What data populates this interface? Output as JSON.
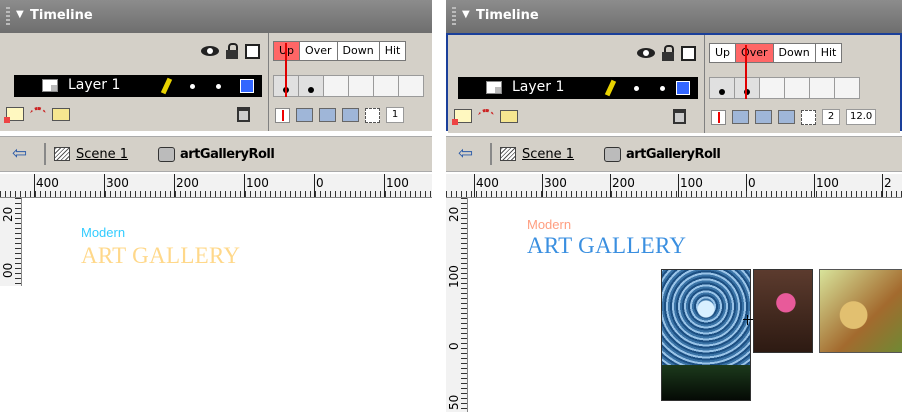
{
  "colors": {
    "header_bg": "#7a7a7a",
    "panel_bg": "#d4d0c8",
    "active_frame_label": "#ff6666",
    "playhead": "#e00000",
    "layer_color": "#3366ff",
    "left_subtitle": "#33ccff",
    "left_title": "#ffd88a",
    "right_subtitle": "#ff9e80",
    "right_title": "#3a8fe0"
  },
  "left": {
    "timeline": {
      "title": "Timeline",
      "frame_labels": [
        "Up",
        "Over",
        "Down",
        "Hit"
      ],
      "active_frame": "Up",
      "layer_name": "Layer 1",
      "frame_counter": "1"
    },
    "breadcrumb": {
      "scene": "Scene 1",
      "symbol": "artGalleryRoll"
    },
    "ruler": {
      "h_numbers": [
        "400",
        "300",
        "200",
        "100",
        "0",
        "100"
      ],
      "v_numbers": [
        "20",
        "00"
      ]
    },
    "stage": {
      "subtitle": "Modern",
      "title": "ART GALLERY"
    }
  },
  "right": {
    "timeline": {
      "title": "Timeline",
      "frame_labels": [
        "Up",
        "Over",
        "Down",
        "Hit"
      ],
      "active_frame": "Over",
      "layer_name": "Layer 1",
      "frame_counter": "2",
      "fps": "12.0"
    },
    "breadcrumb": {
      "scene": "Scene 1",
      "symbol": "artGalleryRoll"
    },
    "ruler": {
      "h_numbers": [
        "400",
        "300",
        "200",
        "100",
        "0",
        "100",
        "2"
      ],
      "v_numbers": [
        "20",
        "100",
        "0",
        "50"
      ]
    },
    "stage": {
      "subtitle": "Modern",
      "title": "ART GALLERY"
    }
  }
}
